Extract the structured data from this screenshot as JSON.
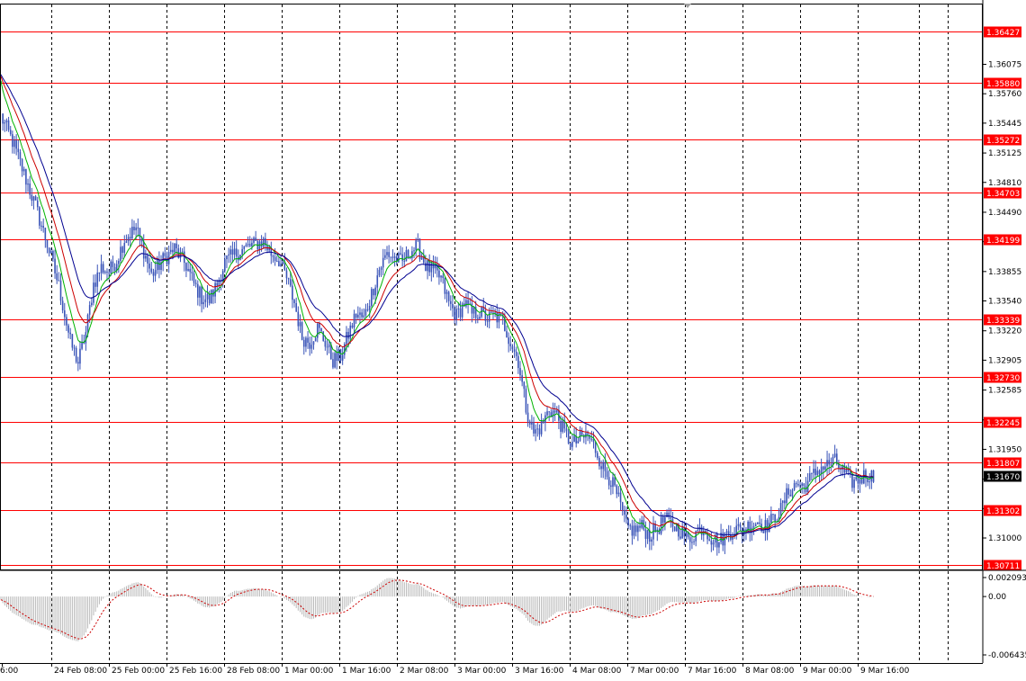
{
  "chart_data": {
    "type": "candlestick",
    "price_axis": {
      "ylim": [
        1.305,
        1.368
      ],
      "ticks": [
        "1.36075",
        "1.35760",
        "1.35445",
        "1.35125",
        "1.34810",
        "1.34490",
        "1.34175",
        "1.33855",
        "1.33540",
        "1.33220",
        "1.32905",
        "1.32585",
        "1.32265",
        "1.31950",
        "1.31630",
        "1.31315",
        "1.31000"
      ]
    },
    "current_price": "1.31670",
    "levels": [
      {
        "value": "1.36427"
      },
      {
        "value": "1.35880"
      },
      {
        "value": "1.35272"
      },
      {
        "value": "1.34703"
      },
      {
        "value": "1.34199"
      },
      {
        "value": "1.33339"
      },
      {
        "value": "1.32730"
      },
      {
        "value": "1.32245"
      },
      {
        "value": "1.31807"
      },
      {
        "value": "1.31302"
      },
      {
        "value": "1.30711"
      }
    ],
    "time_labels": [
      "6:00",
      "24 Feb 08:00",
      "25 Feb 00:00",
      "25 Feb 16:00",
      "28 Feb 08:00",
      "1 Mar 00:00",
      "1 Mar 16:00",
      "2 Mar 08:00",
      "3 Mar 00:00",
      "3 Mar 16:00",
      "4 Mar 08:00",
      "7 Mar 00:00",
      "7 Mar 16:00",
      "8 Mar 08:00",
      "9 Mar 00:00",
      "9 Mar 16:00"
    ],
    "close_path": [
      [
        0,
        1.3552
      ],
      [
        6,
        1.3525
      ],
      [
        12,
        1.349
      ],
      [
        18,
        1.3455
      ],
      [
        24,
        1.3415
      ],
      [
        30,
        1.337
      ],
      [
        36,
        1.331
      ],
      [
        40,
        1.3288
      ],
      [
        44,
        1.332
      ],
      [
        48,
        1.3372
      ],
      [
        52,
        1.339
      ],
      [
        56,
        1.3385
      ],
      [
        60,
        1.3398
      ],
      [
        64,
        1.342
      ],
      [
        70,
        1.3432
      ],
      [
        74,
        1.3408
      ],
      [
        78,
        1.3382
      ],
      [
        84,
        1.3398
      ],
      [
        90,
        1.341
      ],
      [
        96,
        1.3392
      ],
      [
        100,
        1.3372
      ],
      [
        104,
        1.3358
      ],
      [
        108,
        1.3355
      ],
      [
        112,
        1.3372
      ],
      [
        116,
        1.3395
      ],
      [
        120,
        1.3402
      ],
      [
        124,
        1.3408
      ],
      [
        128,
        1.3412
      ],
      [
        132,
        1.3415
      ],
      [
        136,
        1.3418
      ],
      [
        140,
        1.3405
      ],
      [
        144,
        1.3398
      ],
      [
        148,
        1.3378
      ],
      [
        152,
        1.3352
      ],
      [
        156,
        1.3315
      ],
      [
        160,
        1.331
      ],
      [
        164,
        1.3325
      ],
      [
        168,
        1.331
      ],
      [
        172,
        1.329
      ],
      [
        176,
        1.3295
      ],
      [
        180,
        1.3318
      ],
      [
        184,
        1.334
      ],
      [
        188,
        1.3335
      ],
      [
        192,
        1.3362
      ],
      [
        196,
        1.3388
      ],
      [
        200,
        1.3405
      ],
      [
        204,
        1.34
      ],
      [
        208,
        1.3395
      ],
      [
        212,
        1.3408
      ],
      [
        216,
        1.3412
      ],
      [
        220,
        1.3392
      ],
      [
        224,
        1.3385
      ],
      [
        228,
        1.3378
      ],
      [
        232,
        1.3352
      ],
      [
        236,
        1.3338
      ],
      [
        240,
        1.3352
      ],
      [
        244,
        1.334
      ],
      [
        248,
        1.3342
      ],
      [
        252,
        1.3335
      ],
      [
        256,
        1.3338
      ],
      [
        260,
        1.3332
      ],
      [
        264,
        1.331
      ],
      [
        268,
        1.329
      ],
      [
        272,
        1.324
      ],
      [
        276,
        1.3212
      ],
      [
        280,
        1.322
      ],
      [
        284,
        1.3238
      ],
      [
        288,
        1.3232
      ],
      [
        292,
        1.3212
      ],
      [
        296,
        1.32
      ],
      [
        300,
        1.3206
      ],
      [
        304,
        1.321
      ],
      [
        308,
        1.3195
      ],
      [
        312,
        1.3175
      ],
      [
        316,
        1.3162
      ],
      [
        320,
        1.314
      ],
      [
        324,
        1.3112
      ],
      [
        328,
        1.3108
      ],
      [
        332,
        1.3112
      ],
      [
        336,
        1.3103
      ],
      [
        340,
        1.311
      ],
      [
        344,
        1.312
      ],
      [
        348,
        1.3114
      ],
      [
        352,
        1.3108
      ],
      [
        356,
        1.3098
      ],
      [
        360,
        1.3106
      ],
      [
        364,
        1.3112
      ],
      [
        368,
        1.31
      ],
      [
        372,
        1.3096
      ],
      [
        376,
        1.3104
      ],
      [
        380,
        1.311
      ],
      [
        384,
        1.3108
      ],
      [
        388,
        1.3114
      ],
      [
        392,
        1.3118
      ],
      [
        396,
        1.3112
      ],
      [
        400,
        1.312
      ],
      [
        404,
        1.313
      ],
      [
        408,
        1.315
      ],
      [
        412,
        1.3158
      ],
      [
        416,
        1.3155
      ],
      [
        420,
        1.3165
      ],
      [
        424,
        1.3175
      ],
      [
        428,
        1.3178
      ],
      [
        432,
        1.3182
      ],
      [
        436,
        1.3172
      ],
      [
        440,
        1.316
      ],
      [
        444,
        1.3162
      ],
      [
        448,
        1.3168
      ],
      [
        452,
        1.3166
      ]
    ],
    "macd": {
      "ylim": [
        -0.006435,
        0.002093
      ],
      "ticks": [
        "0.002093",
        "0.00",
        "-0.006435"
      ]
    },
    "colors": {
      "level": "#ff0000",
      "candle": "#3a54b8",
      "ma_fast": "#00b300",
      "ma_mid": "#cc0000",
      "ma_slow": "#000090",
      "grid": "#000000",
      "price_tag": "#000000"
    }
  }
}
